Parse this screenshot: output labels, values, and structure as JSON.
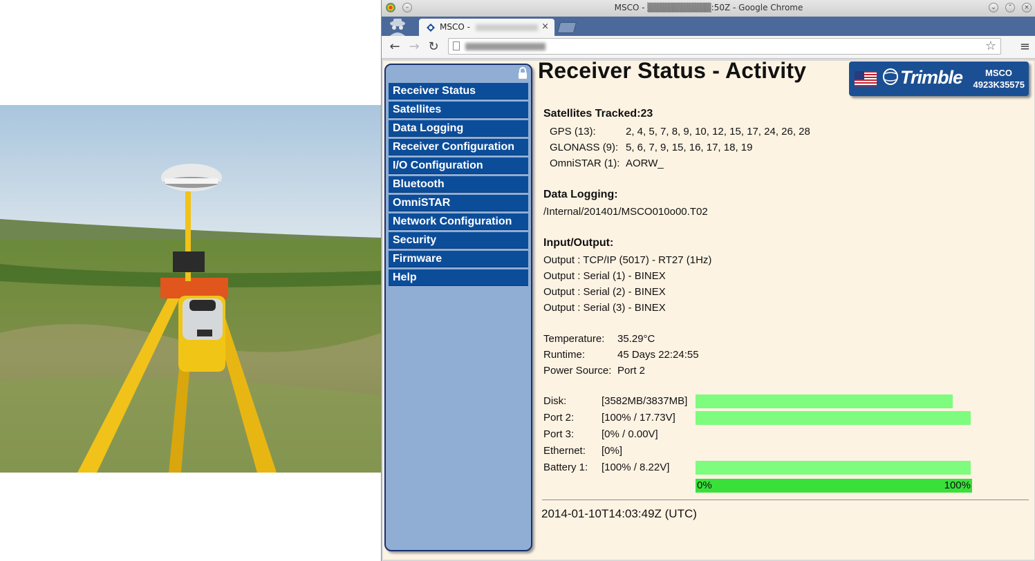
{
  "browser": {
    "window_title": "MSCO - ▒▒▒▒▒▒▒▒▒▒:50Z - Google Chrome",
    "tab_label": "MSCO -",
    "tab_close": "×"
  },
  "sidebar": {
    "items": [
      {
        "label": "Receiver Status"
      },
      {
        "label": "Satellites"
      },
      {
        "label": "Data Logging"
      },
      {
        "label": "Receiver Configuration"
      },
      {
        "label": "I/O Configuration"
      },
      {
        "label": "Bluetooth"
      },
      {
        "label": "OmniSTAR"
      },
      {
        "label": "Network Configuration"
      },
      {
        "label": "Security"
      },
      {
        "label": "Firmware"
      },
      {
        "label": "Help"
      }
    ]
  },
  "page": {
    "title": "Receiver Status - Activity"
  },
  "logo": {
    "brand": "Trimble",
    "receiver_name": "MSCO",
    "serial": "4923K35575"
  },
  "satellites": {
    "heading": "Satellites Tracked:23",
    "rows": [
      {
        "label": "GPS (13):",
        "value": "2, 4, 5, 7, 8, 9, 10, 12, 15, 17, 24, 26, 28"
      },
      {
        "label": "GLONASS (9):",
        "value": "5, 6, 7, 9, 15, 16, 17, 18, 19"
      },
      {
        "label": "OmniSTAR (1):",
        "value": "AORW_"
      }
    ]
  },
  "data_logging": {
    "heading": "Data Logging:",
    "file": "/Internal/201401/MSCO010o00.T02"
  },
  "io": {
    "heading": "Input/Output:",
    "outputs": [
      "Output : TCP/IP (5017) - RT27 (1Hz)",
      "Output : Serial (1) - BINEX",
      "Output : Serial (2) - BINEX",
      "Output : Serial (3) - BINEX"
    ]
  },
  "status": {
    "temperature_label": "Temperature:",
    "temperature": "35.29°C",
    "runtime_label": "Runtime:",
    "runtime": "45 Days 22:24:55",
    "power_label": "Power Source:",
    "power": "Port 2"
  },
  "resources": [
    {
      "label": "Disk:",
      "value": "[3582MB/3837MB]",
      "fraction": 0.9335
    },
    {
      "label": "Port 2:",
      "value": "[100% / 17.73V]",
      "fraction": 1.0
    },
    {
      "label": "Port 3:",
      "value": "[0% / 0.00V]",
      "fraction": 0.0
    },
    {
      "label": "Ethernet:",
      "value": "[0%]",
      "fraction": 0.0
    },
    {
      "label": "Battery 1:",
      "value": "[100% / 8.22V]",
      "fraction": 1.0
    }
  ],
  "scale": {
    "min_label": "0%",
    "max_label": "100%"
  },
  "footer": {
    "timestamp": "2014-01-10T14:03:49Z (UTC)"
  },
  "colors": {
    "nav_item_bg": "#0c4d9a",
    "sidebar_bg": "#90aed4",
    "content_bg": "#fdf3e3",
    "bar_fill": "#7dfc7d",
    "scale_fill": "#39e03a",
    "logo_bg": "#1b4f93"
  }
}
